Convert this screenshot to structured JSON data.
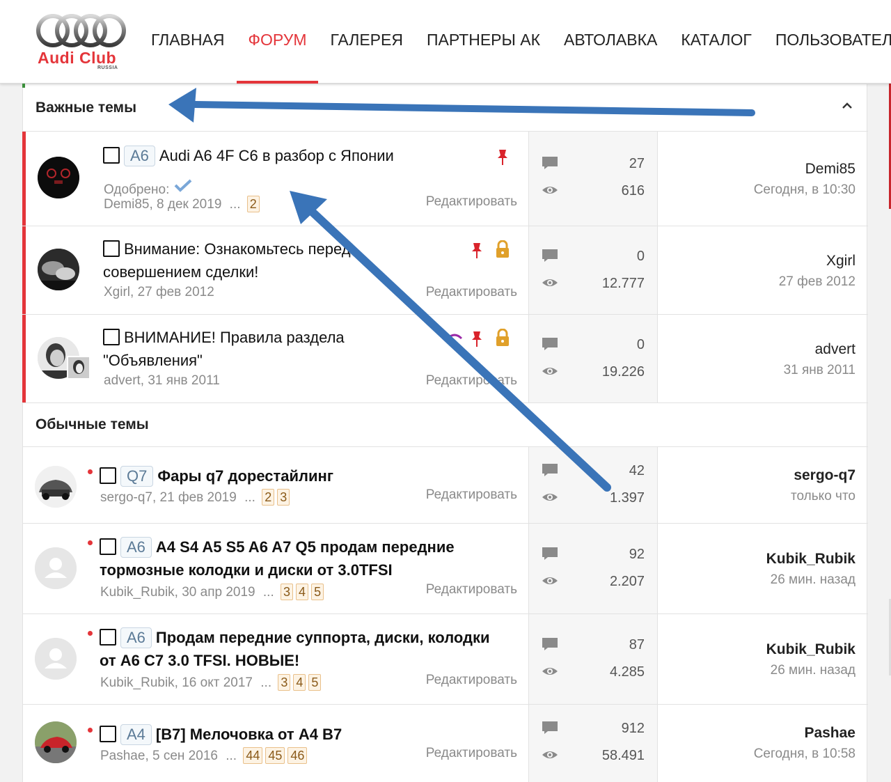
{
  "logo": {
    "text": "Audi Club",
    "sub": "RUSSIA"
  },
  "nav": [
    {
      "label": "ГЛАВНАЯ"
    },
    {
      "label": "ФОРУМ"
    },
    {
      "label": "ГАЛЕРЕЯ"
    },
    {
      "label": "ПАРТНЕРЫ АК"
    },
    {
      "label": "АВТОЛАВКА"
    },
    {
      "label": "КАТАЛОГ"
    },
    {
      "label": "ПОЛЬЗОВАТЕЛИ"
    }
  ],
  "colors": {
    "accent": "#e4353a",
    "prefix": "#5c7b97",
    "page_badge": "#fdf3e4",
    "arrow": "#3a74b8"
  },
  "sticky_section": {
    "title": "Важные темы",
    "collapse_icon": "chevron-up-icon"
  },
  "normal_section": {
    "title": "Обычные темы"
  },
  "edit_label": "Редактировать",
  "approved_label": "Одобрено:",
  "ellipsis": "...",
  "sticky": [
    {
      "prefix": "A6",
      "title1": "Audi A6 4F C6 в разбор с Японии",
      "title2": "",
      "meta": "Demi85, 8 дек 2019",
      "pages": [
        "2"
      ],
      "replies": "27",
      "views": "616",
      "last_user": "Demi85",
      "last_date": "Сегодня, в 10:30",
      "approved": true,
      "locked": false
    },
    {
      "prefix": "",
      "title1": "Внимание: Ознакомьтесь перед",
      "title2": "совершением сделки!",
      "meta": "Xgirl, 27 фев 2012",
      "pages": [],
      "replies": "0",
      "views": "12.777",
      "last_user": "Xgirl",
      "last_date": "27 фев 2012",
      "approved": false,
      "locked": true
    },
    {
      "prefix": "",
      "title1": "ВНИМАНИЕ! Правила раздела",
      "title2": "\"Объявления\"",
      "meta": "advert, 31 янв 2011",
      "pages": [],
      "replies": "0",
      "views": "19.226",
      "last_user": "advert",
      "last_date": "31 янв 2011",
      "approved": false,
      "locked": true
    }
  ],
  "normal": [
    {
      "prefix": "Q7",
      "title1": "Фары q7 дорестайлинг",
      "title2": "",
      "meta": "sergo-q7, 21 фев 2019",
      "pages": [
        "2",
        "3"
      ],
      "replies": "42",
      "views": "1.397",
      "last_user": "sergo-q7",
      "last_date": "только что"
    },
    {
      "prefix": "A6",
      "title1": "A4 S4 A5 S5 A6 A7 Q5 продам передние",
      "title2": "тормозные колодки и диски от 3.0TFSI",
      "meta": "Kubik_Rubik, 30 апр 2019",
      "pages": [
        "3",
        "4",
        "5"
      ],
      "replies": "92",
      "views": "2.207",
      "last_user": "Kubik_Rubik",
      "last_date": "26 мин. назад"
    },
    {
      "prefix": "A6",
      "title1": "Продам передние суппорта, диски, колодки",
      "title2": "от A6 C7 3.0 TFSI. НОВЫЕ!",
      "meta": "Kubik_Rubik, 16 окт 2017",
      "pages": [
        "3",
        "4",
        "5"
      ],
      "replies": "87",
      "views": "4.285",
      "last_user": "Kubik_Rubik",
      "last_date": "26 мин. назад"
    },
    {
      "prefix": "A4",
      "title1": "[B7] Мелочовка от A4 B7",
      "title2": "",
      "meta": "Pashae, 5 сен 2016",
      "pages": [
        "44",
        "45",
        "46"
      ],
      "replies": "912",
      "views": "58.491",
      "last_user": "Pashae",
      "last_date": "Сегодня, в 10:58"
    }
  ]
}
